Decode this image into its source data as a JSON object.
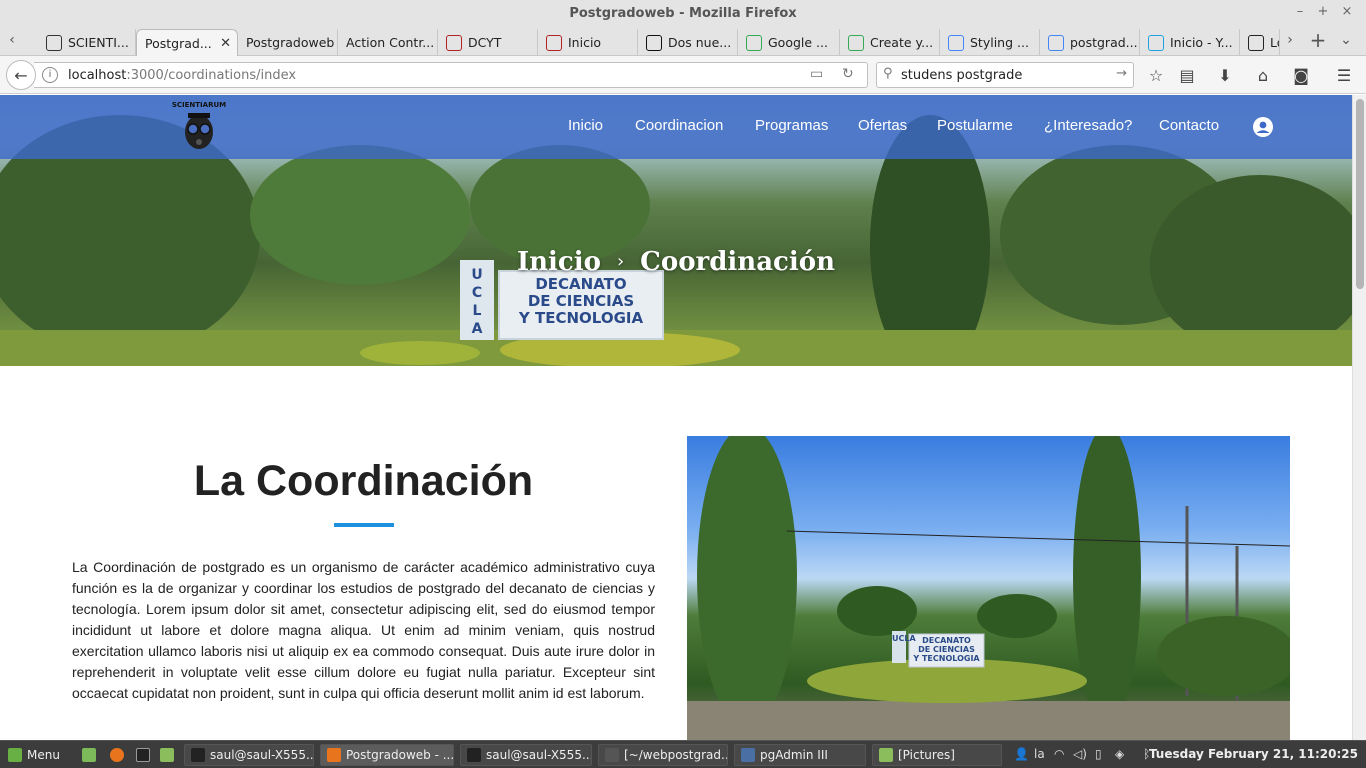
{
  "window": {
    "title": "Postgradoweb - Mozilla Firefox"
  },
  "tabs": [
    {
      "label": "SCIENTI...",
      "favicon": "owl-favicon",
      "color": "#333333"
    },
    {
      "label": "Postgrad...",
      "favicon": "none",
      "active": true
    },
    {
      "label": "Postgradoweb",
      "favicon": "none"
    },
    {
      "label": "Action Contr...",
      "favicon": "none"
    },
    {
      "label": "DCYT",
      "favicon": "dcyt-favicon",
      "color": "#b22222"
    },
    {
      "label": "Inicio",
      "favicon": "inicio-favicon",
      "color": "#b22222"
    },
    {
      "label": "Dos nue...",
      "favicon": "mp-favicon",
      "color": "#111111"
    },
    {
      "label": "Google ...",
      "favicon": "maps-favicon",
      "color": "#34a853"
    },
    {
      "label": "Create y...",
      "favicon": "maps-pin-favicon",
      "color": "#34a853"
    },
    {
      "label": "Styling ...",
      "favicon": "maps-favicon",
      "color": "#4285f4"
    },
    {
      "label": "postgrad...",
      "favicon": "google-favicon",
      "color": "#4285f4"
    },
    {
      "label": "Inicio - Y...",
      "favicon": "yahoo-favicon",
      "color": "#1fa3e0"
    },
    {
      "label": "Lo",
      "favicon": "l-favicon",
      "color": "#222222"
    }
  ],
  "url": {
    "host": "localhost",
    "path": ":3000/coordinations/index"
  },
  "search": {
    "value": "studens postgrade"
  },
  "site": {
    "logo_text": "SCIENTIARUM",
    "menu": [
      "Inicio",
      "Coordinacion",
      "Programas",
      "Ofertas",
      "Postularme",
      "¿Interesado?",
      "Contacto"
    ],
    "breadcrumb": {
      "home": "Inicio",
      "separator": "›",
      "current": "Coordinación"
    },
    "hero_sign": {
      "side": "UCLA",
      "line1": "DECANATO",
      "line2": "DE CIENCIAS",
      "line3": "Y TECNOLOGIA"
    },
    "section": {
      "title": "La Coordinación",
      "paragraph": "La Coordinación de postgrado es un organismo de carácter académico administrativo cuya función es la de organizar y coordinar los estudios de postgrado del decanato de ciencias y tecnología. Lorem ipsum dolor sit amet, consectetur adipiscing elit, sed do eiusmod tempor incididunt ut labore et dolore magna aliqua. Ut enim ad minim veniam, quis nostrud exercitation ullamco laboris nisi ut aliquip ex ea commodo consequat. Duis aute irure dolor in reprehenderit in voluptate velit esse cillum dolore eu fugiat nulla pariatur. Excepteur sint occaecat cupidatat non proident, sunt in culpa qui officia deserunt mollit anim id est laborum."
    },
    "photo_sign": {
      "side": "UCLA",
      "line1": "DECANATO",
      "line2": "DE CIENCIAS",
      "line3": "Y TECNOLOGIA"
    },
    "accent_color": "#1e90e0",
    "nav_color": "#3d69c8"
  },
  "taskbar": {
    "menu_label": "Menu",
    "windows": [
      {
        "label": "saul@saul-X555...",
        "icon": "terminal-icon"
      },
      {
        "label": "Postgradoweb - ...",
        "icon": "firefox-icon",
        "active": true
      },
      {
        "label": "saul@saul-X555...",
        "icon": "terminal-icon"
      },
      {
        "label": "[~/webpostgrad...",
        "icon": "sublime-icon"
      },
      {
        "label": "pgAdmin III",
        "icon": "pgadmin-icon"
      },
      {
        "label": "[Pictures]",
        "icon": "folder-icon"
      }
    ],
    "keyboard_layout": "la",
    "clock": "Tuesday February 21, 11:20:25"
  }
}
